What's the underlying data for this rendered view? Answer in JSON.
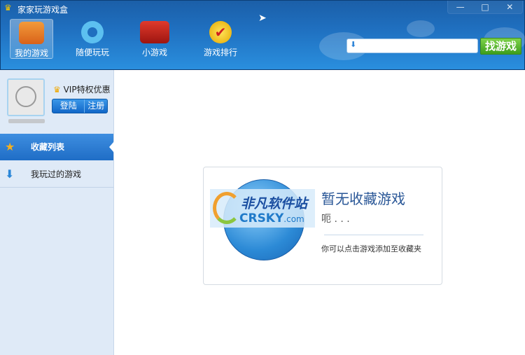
{
  "window": {
    "title": "家家玩游戏盒",
    "minimize": "—",
    "maximize": "□",
    "close": "✕"
  },
  "nav": [
    {
      "label": "我的游戏",
      "active": true
    },
    {
      "label": "随便玩玩"
    },
    {
      "label": "小游戏"
    },
    {
      "label": "游戏排行"
    }
  ],
  "search": {
    "value": "",
    "placeholder": "",
    "button": "找游戏"
  },
  "user": {
    "vip_label": "VIP特权优惠",
    "login": "登陆",
    "register": "注册"
  },
  "sidebar": {
    "items": [
      {
        "label": "收藏列表",
        "active": true
      },
      {
        "label": "我玩过的游戏"
      }
    ]
  },
  "empty": {
    "title": "暂无收藏游戏",
    "subtitle": "呃 . . .",
    "hint": "你可以点击游戏添加至收藏夹",
    "watermark_cn": "非凡软件站",
    "watermark_en": "CRSKY",
    "watermark_tld": ".com"
  }
}
